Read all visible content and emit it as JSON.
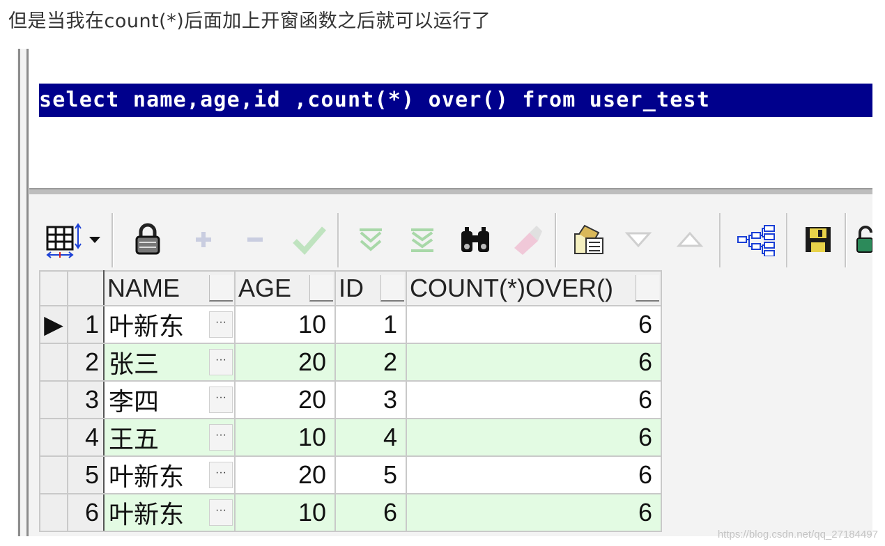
{
  "caption": "但是当我在count(*)后面加上开窗函数之后就可以运行了",
  "editor": {
    "sql": "select name,age,id ,count(*) over() from user_test"
  },
  "toolbar": {
    "buttons": [
      {
        "name": "grid-layout-icon"
      },
      {
        "name": "dropdown-arrow-icon"
      },
      {
        "name": "lock-icon"
      },
      {
        "name": "add-record-icon"
      },
      {
        "name": "delete-record-icon"
      },
      {
        "name": "post-changes-icon"
      },
      {
        "name": "fetch-next-icon"
      },
      {
        "name": "fetch-last-icon"
      },
      {
        "name": "find-icon"
      },
      {
        "name": "clear-icon"
      },
      {
        "name": "export-icon"
      },
      {
        "name": "sort-descending-icon"
      },
      {
        "name": "sort-ascending-icon"
      },
      {
        "name": "query-tree-icon"
      },
      {
        "name": "save-icon"
      },
      {
        "name": "more-icon"
      }
    ]
  },
  "grid": {
    "columns": [
      "NAME",
      "AGE",
      "ID",
      "COUNT(*)OVER()"
    ],
    "row_numbers": [
      "1",
      "2",
      "3",
      "4",
      "5",
      "6"
    ],
    "current_row_marker": "▶",
    "cell_button": "···",
    "rows": [
      [
        "叶新东",
        "10",
        "1",
        "6"
      ],
      [
        "张三",
        "20",
        "2",
        "6"
      ],
      [
        "李四",
        "20",
        "3",
        "6"
      ],
      [
        "王五",
        "10",
        "4",
        "6"
      ],
      [
        "叶新东",
        "20",
        "5",
        "6"
      ],
      [
        "叶新东",
        "10",
        "6",
        "6"
      ]
    ],
    "colors": {
      "alt_row": "#e3fbe3",
      "selection": "#00008c"
    }
  },
  "watermark": "https://blog.csdn.net/qq_27184497"
}
